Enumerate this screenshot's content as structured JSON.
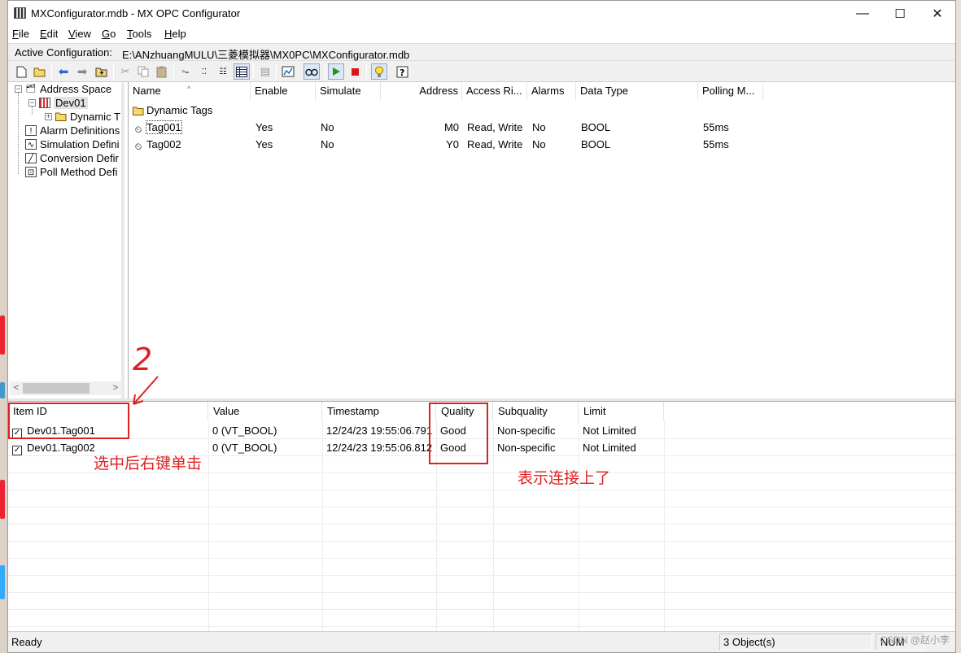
{
  "window": {
    "title": "MXConfigurator.mdb - MX OPC Configurator",
    "controls": {
      "minimize": "—",
      "maximize": "☐",
      "close": "✕"
    }
  },
  "menu": {
    "items": [
      {
        "label": "File",
        "accel": "F",
        "rest": "ile"
      },
      {
        "label": "Edit",
        "accel": "E",
        "rest": "dit"
      },
      {
        "label": "View",
        "accel": "V",
        "rest": "iew"
      },
      {
        "label": "Go",
        "accel": "G",
        "rest": "o"
      },
      {
        "label": "Tools",
        "accel": "T",
        "rest": "ools"
      },
      {
        "label": "Help",
        "accel": "H",
        "rest": "elp"
      }
    ]
  },
  "active_config": {
    "label": "Active Configuration:",
    "path": "E:\\ANzhuangMULU\\三菱模拟器\\MX0PC\\MXConfigurator.mdb"
  },
  "toolbar": {
    "icons": [
      "new-icon",
      "open-icon",
      "back-icon",
      "forward-icon",
      "up-folder-icon",
      "cut-icon",
      "copy-icon",
      "paste-icon",
      "large-icons-icon",
      "small-icons-icon",
      "list-icon",
      "details-icon",
      "properties-icon",
      "monitor-icon",
      "dual-view-icon",
      "run-icon",
      "stop-icon",
      "bulb-icon",
      "help-icon"
    ]
  },
  "tree": {
    "address_space": "Address Space",
    "device": "Dev01",
    "dynamic": "Dynamic T",
    "alarm": "Alarm Definitions",
    "simulation": "Simulation Defini",
    "conversion": "Conversion Defir",
    "poll": "Poll Method Defi"
  },
  "list": {
    "columns": [
      "Name",
      "Enable",
      "Simulate",
      "Address",
      "Access Ri...",
      "Alarms",
      "Data Type",
      "Polling M..."
    ],
    "folder": "Dynamic Tags",
    "rows": [
      {
        "name": "Tag001",
        "enable": "Yes",
        "simulate": "No",
        "address": "M0",
        "access": "Read, Write",
        "alarms": "No",
        "type": "BOOL",
        "polling": "55ms"
      },
      {
        "name": "Tag002",
        "enable": "Yes",
        "simulate": "No",
        "address": "Y0",
        "access": "Read, Write",
        "alarms": "No",
        "type": "BOOL",
        "polling": "55ms"
      }
    ]
  },
  "monitor": {
    "columns": [
      "Item ID",
      "Value",
      "Timestamp",
      "Quality",
      "Subquality",
      "Limit"
    ],
    "rows": [
      {
        "checked": true,
        "item": "Dev01.Tag001",
        "value": "0 (VT_BOOL)",
        "timestamp": "12/24/23 19:55:06.791",
        "quality": "Good",
        "subquality": "Non-specific",
        "limit": "Not Limited"
      },
      {
        "checked": true,
        "item": "Dev01.Tag002",
        "value": "0 (VT_BOOL)",
        "timestamp": "12/24/23 19:55:06.812",
        "quality": "Good",
        "subquality": "Non-specific",
        "limit": "Not Limited"
      }
    ]
  },
  "status": {
    "ready": "Ready",
    "objects": "3 Object(s)",
    "num": "NUM"
  },
  "annotations": {
    "step": "2",
    "right_click_note": "选中后右键单击",
    "connected_note": "表示连接上了"
  },
  "watermark": "CSDN @赵小李",
  "colors": {
    "annotation": "#e02020",
    "run": "#1a9a1a",
    "stop": "#d81818"
  }
}
